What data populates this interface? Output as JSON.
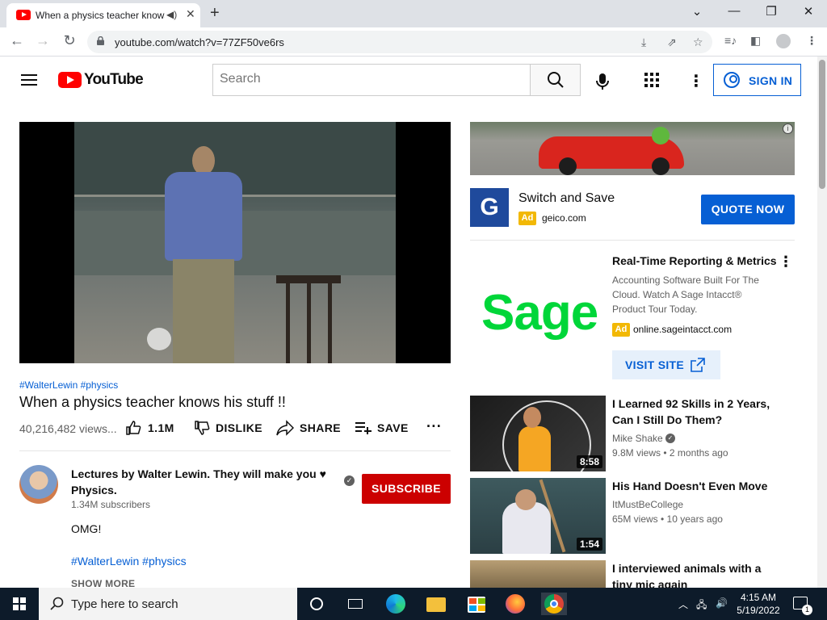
{
  "browser": {
    "tab_title": "When a physics teacher knows his stuff !!",
    "url": "youtube.com/watch?v=77ZF50ve6rs"
  },
  "youtube_header": {
    "logo_text": "YouTube",
    "search_placeholder": "Search",
    "signin_label": "SIGN IN"
  },
  "video": {
    "hashtags": "#WalterLewin #physics",
    "title": "When a physics teacher knows his stuff !!",
    "views": "40,216,482 views...",
    "likes": "1.1M",
    "dislike_label": "DISLIKE",
    "share_label": "SHARE",
    "save_label": "SAVE"
  },
  "channel": {
    "name": "Lectures by Walter Lewin. They will make you ♥ Physics.",
    "subscribers": "1.34M subscribers",
    "subscribe_label": "SUBSCRIBE",
    "description": "OMG!",
    "description_tags": "#WalterLewin #physics",
    "show_more": "SHOW MORE"
  },
  "ads": {
    "geico": {
      "title": "Switch and Save",
      "badge": "Ad",
      "domain": "geico.com",
      "cta": "QUOTE NOW",
      "logo_letter": "G"
    },
    "sage": {
      "logo_text": "Sage",
      "title": "Real-Time Reporting & Metrics",
      "description": "Accounting Software Built For The Cloud. Watch A Sage Intacct® Product Tour Today.",
      "badge": "Ad",
      "domain": "online.sageintacct.com",
      "cta": "VISIT SITE"
    }
  },
  "recommendations": [
    {
      "title": "I Learned 92 Skills in 2 Years, Can I Still Do Them?",
      "channel": "Mike Shake",
      "meta": "9.8M views • 2 months ago",
      "duration": "8:58"
    },
    {
      "title": "His Hand Doesn't Even Move",
      "channel": "ItMustBeCollege",
      "meta": "65M views • 10 years ago",
      "duration": "1:54"
    },
    {
      "title": "I interviewed animals with a tiny mic again",
      "channel": "",
      "meta": "",
      "duration": ""
    }
  ],
  "taskbar": {
    "search_placeholder": "Type here to search",
    "time": "4:15 AM",
    "date": "5/19/2022",
    "notification_count": "1"
  }
}
